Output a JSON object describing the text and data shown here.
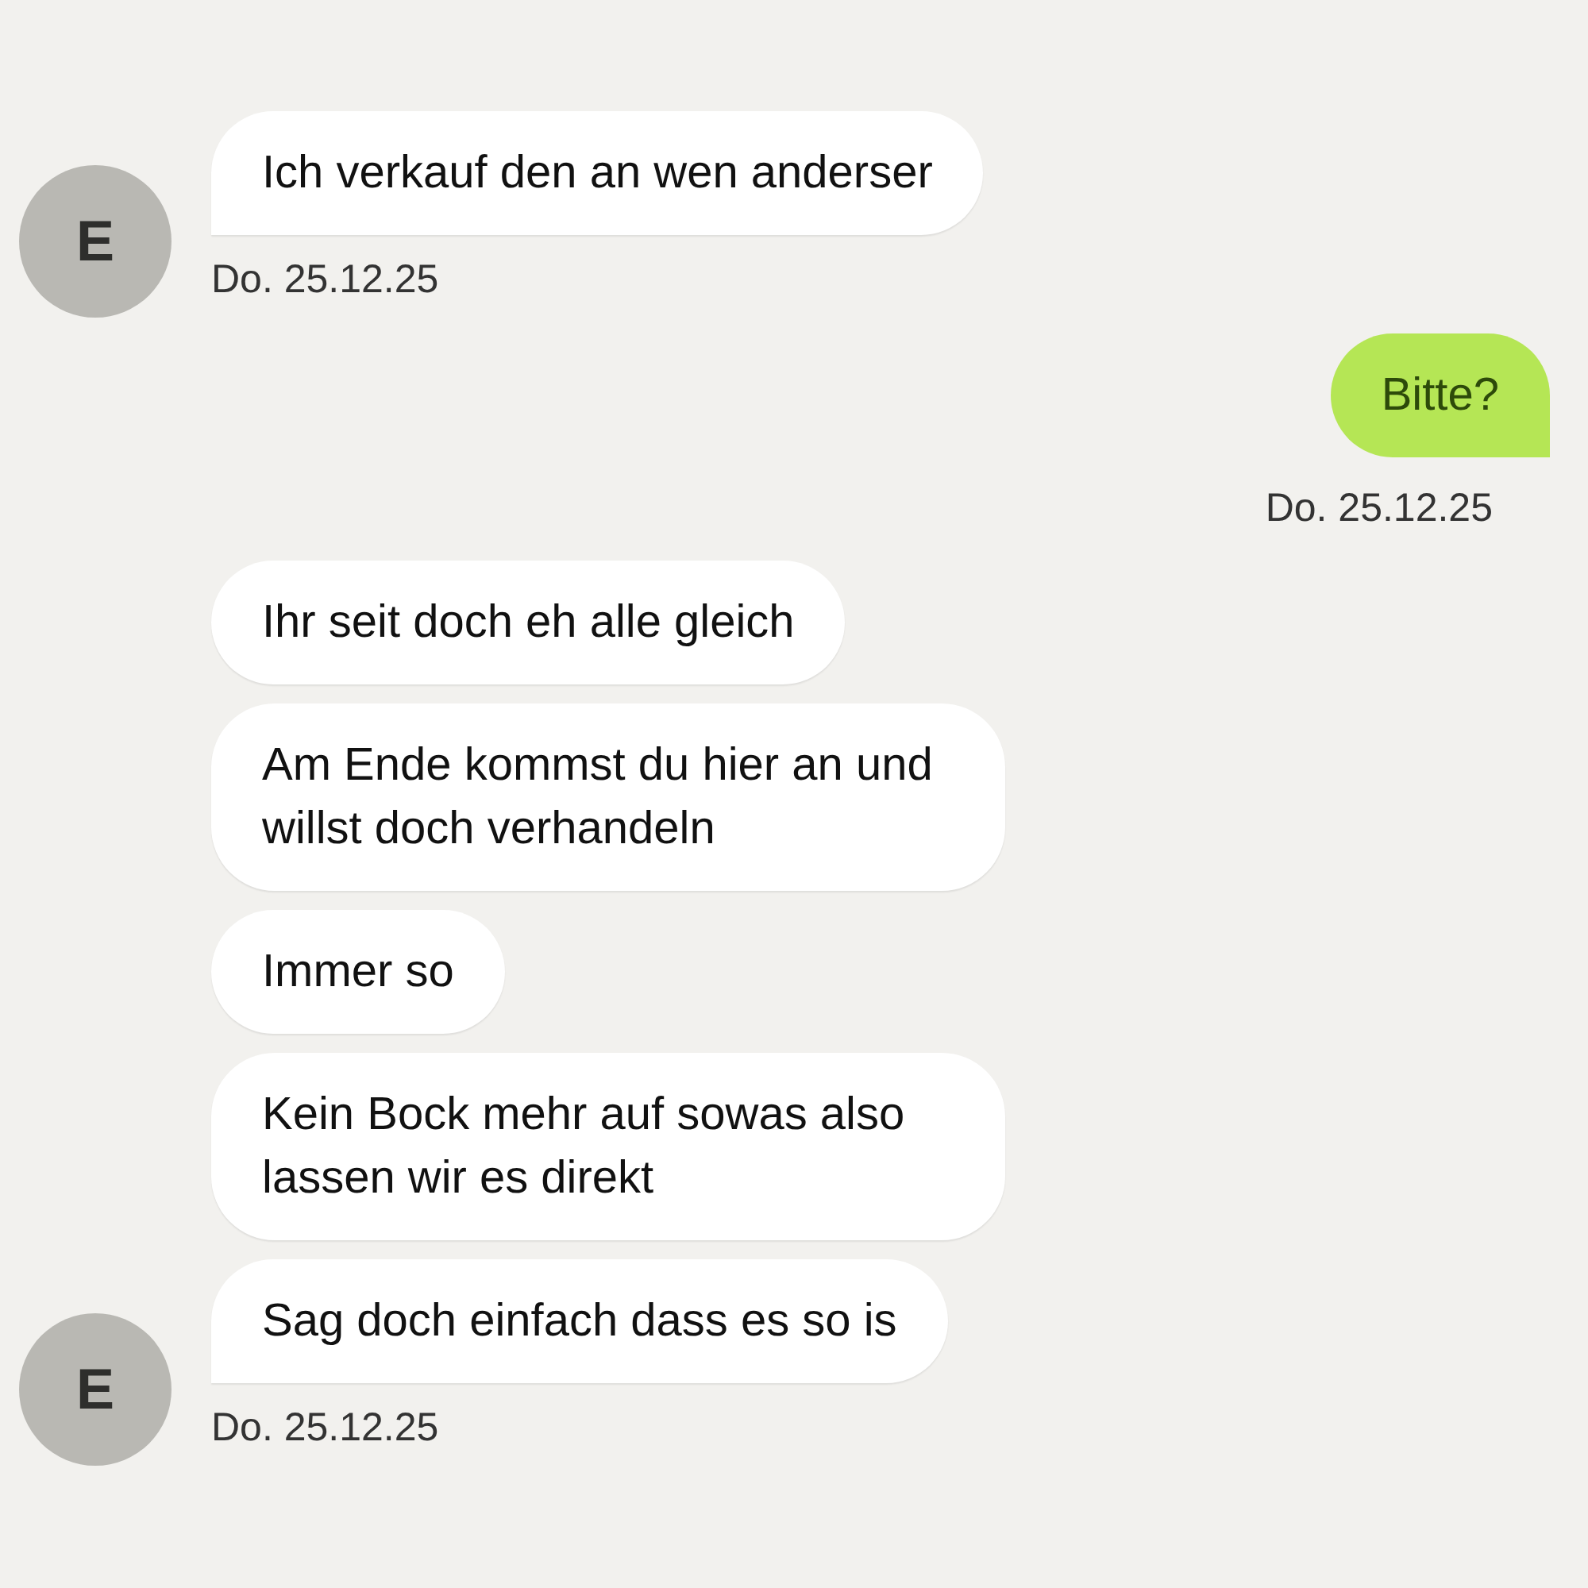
{
  "groups": [
    {
      "kind": "incoming",
      "avatar": "E",
      "messages": [
        "Ich verkauf den an wen anderser"
      ],
      "time": "Do. 25.12.25"
    },
    {
      "kind": "outgoing",
      "messages": [
        "Bitte?"
      ],
      "time": "Do. 25.12.25"
    },
    {
      "kind": "incoming",
      "avatar": "E",
      "messages": [
        "Ihr seit doch eh alle gleich",
        "Am Ende kommst du hier an und willst doch verhandeln",
        "Immer so",
        "Kein Bock mehr auf sowas also lassen wir es direkt",
        "Sag doch einfach dass es so is"
      ],
      "time": "Do. 25.12.25"
    }
  ]
}
